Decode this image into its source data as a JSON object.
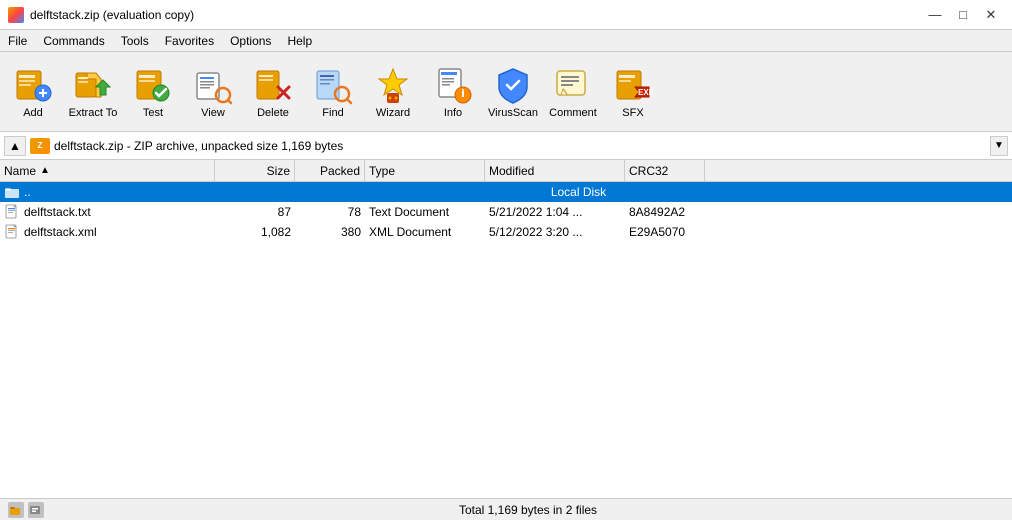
{
  "window": {
    "title": "delftstack.zip (evaluation copy)",
    "icon": "zip-icon"
  },
  "title_controls": {
    "minimize": "—",
    "maximize": "□",
    "close": "✕"
  },
  "menu": {
    "items": [
      "File",
      "Commands",
      "Tools",
      "Favorites",
      "Options",
      "Help"
    ]
  },
  "toolbar": {
    "buttons": [
      {
        "id": "add",
        "label": "Add",
        "icon": "📦"
      },
      {
        "id": "extract",
        "label": "Extract To",
        "icon": "📂"
      },
      {
        "id": "test",
        "label": "Test",
        "icon": "✅"
      },
      {
        "id": "view",
        "label": "View",
        "icon": "🔍"
      },
      {
        "id": "delete",
        "label": "Delete",
        "icon": "🗑️"
      },
      {
        "id": "find",
        "label": "Find",
        "icon": "🔎"
      },
      {
        "id": "wizard",
        "label": "Wizard",
        "icon": "🧙"
      },
      {
        "id": "info",
        "label": "Info",
        "icon": "ℹ️"
      },
      {
        "id": "virusscan",
        "label": "VirusScan",
        "icon": "🛡️"
      },
      {
        "id": "comment",
        "label": "Comment",
        "icon": "📝"
      },
      {
        "id": "sfx",
        "label": "SFX",
        "icon": "⚙️"
      }
    ]
  },
  "address_bar": {
    "text": "delftstack.zip - ZIP archive, unpacked size 1,169 bytes",
    "back_label": "↑"
  },
  "columns": {
    "name": "Name",
    "size": "Size",
    "packed": "Packed",
    "type": "Type",
    "modified": "Modified",
    "crc": "CRC32"
  },
  "files": [
    {
      "id": "local-disk",
      "name": "..",
      "size": "",
      "packed": "",
      "type": "Local Disk",
      "modified": "",
      "crc": "",
      "selected": true,
      "icon": "disk"
    },
    {
      "id": "delftstack-txt",
      "name": "delftstack.txt",
      "size": "87",
      "packed": "78",
      "type": "Text Document",
      "modified": "5/21/2022 1:04 ...",
      "crc": "8A8492A2",
      "selected": false,
      "icon": "txt"
    },
    {
      "id": "delftstack-xml",
      "name": "delftstack.xml",
      "size": "1,082",
      "packed": "380",
      "type": "XML Document",
      "modified": "5/12/2022 3:20 ...",
      "crc": "E29A5070",
      "selected": false,
      "icon": "xml"
    }
  ],
  "status_bar": {
    "text": "Total 1,169 bytes in 2 files"
  }
}
